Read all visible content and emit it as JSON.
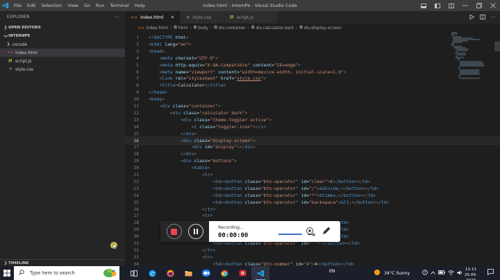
{
  "window": {
    "title": "index.html - InternPe - Visual Studio Code",
    "menu": [
      "File",
      "Edit",
      "Selection",
      "View",
      "Go",
      "Run",
      "Terminal",
      "Help"
    ]
  },
  "explorer": {
    "header": "EXPLORER",
    "more": "···",
    "open_editors": "OPEN EDITORS",
    "project": "INTERNPE",
    "files": [
      {
        "name": ".vscode",
        "kind": "folder"
      },
      {
        "name": "index.html",
        "kind": "html",
        "icon": "<>"
      },
      {
        "name": "script.js",
        "kind": "js",
        "icon": "JS"
      },
      {
        "name": "style.css",
        "kind": "css",
        "icon": "#"
      }
    ],
    "timeline": "TIMELINE"
  },
  "tabs": [
    {
      "label": "index.html",
      "icon": "<>",
      "active": true,
      "color": "#e37933"
    },
    {
      "label": "style.css",
      "icon": "#",
      "active": false,
      "color": "#519aba"
    },
    {
      "label": "script.js",
      "icon": "JS",
      "active": false,
      "color": "#cbcb41"
    }
  ],
  "breadcrumb": [
    "index.html",
    "html",
    "body",
    "div.container",
    "div.calculator.dark",
    "div.display-screen"
  ],
  "current_line": 16,
  "code": [
    {
      "n": "1",
      "indent": 1,
      "t": [
        [
          "p",
          "<!"
        ],
        [
          "d",
          "DOCTYPE"
        ],
        [
          "a",
          " html"
        ],
        [
          "p",
          ">"
        ]
      ]
    },
    {
      "n": "2",
      "indent": 1,
      "t": [
        [
          "p",
          "<"
        ],
        [
          "g",
          "html"
        ],
        [
          "a",
          " lang"
        ],
        [
          "x",
          "="
        ],
        [
          "s",
          "\"en\""
        ],
        [
          "p",
          ">"
        ]
      ]
    },
    {
      "n": "3",
      "indent": 1,
      "t": [
        [
          "p",
          "<"
        ],
        [
          "g",
          "head"
        ],
        [
          "p",
          ">"
        ]
      ]
    },
    {
      "n": "4",
      "indent": 2,
      "t": [
        [
          "p",
          "<"
        ],
        [
          "g",
          "meta"
        ],
        [
          "a",
          " charset"
        ],
        [
          "x",
          "="
        ],
        [
          "s",
          "\"UTF-8\""
        ],
        [
          "p",
          ">"
        ]
      ]
    },
    {
      "n": "5",
      "indent": 2,
      "t": [
        [
          "p",
          "<"
        ],
        [
          "g",
          "meta"
        ],
        [
          "a",
          " http-equiv"
        ],
        [
          "x",
          "="
        ],
        [
          "s",
          "\"X-UA-Compatible\""
        ],
        [
          "a",
          " content"
        ],
        [
          "x",
          "="
        ],
        [
          "s",
          "\"IE=edge\""
        ],
        [
          "p",
          ">"
        ]
      ]
    },
    {
      "n": "6",
      "indent": 2,
      "t": [
        [
          "p",
          "<"
        ],
        [
          "g",
          "meta"
        ],
        [
          "a",
          " name"
        ],
        [
          "x",
          "="
        ],
        [
          "s",
          "\"viewport\""
        ],
        [
          "a",
          " content"
        ],
        [
          "x",
          "="
        ],
        [
          "s",
          "\"width=device-width, initial-scale=1.0\""
        ],
        [
          "p",
          ">"
        ]
      ]
    },
    {
      "n": "7",
      "indent": 2,
      "t": [
        [
          "p",
          "<"
        ],
        [
          "g",
          "link"
        ],
        [
          "a",
          " rel"
        ],
        [
          "x",
          "="
        ],
        [
          "s",
          "\"stylesheet\""
        ],
        [
          "a",
          " href"
        ],
        [
          "x",
          "="
        ],
        [
          "s",
          "\""
        ],
        [
          "l",
          "style.css"
        ],
        [
          "s",
          "\""
        ],
        [
          "p",
          ">"
        ]
      ]
    },
    {
      "n": "8",
      "indent": 2,
      "t": [
        [
          "p",
          "<"
        ],
        [
          "g",
          "title"
        ],
        [
          "p",
          ">"
        ],
        [
          "x",
          "Calculator"
        ],
        [
          "p",
          "</"
        ],
        [
          "g",
          "title"
        ],
        [
          "p",
          ">"
        ]
      ]
    },
    {
      "n": "9",
      "indent": 1,
      "t": [
        [
          "p",
          "</"
        ],
        [
          "g",
          "head"
        ],
        [
          "p",
          ">"
        ]
      ]
    },
    {
      "n": "10",
      "indent": 1,
      "t": [
        [
          "p",
          "<"
        ],
        [
          "g",
          "body"
        ],
        [
          "p",
          ">"
        ]
      ]
    },
    {
      "n": "11",
      "indent": 2,
      "t": [
        [
          "p",
          "<"
        ],
        [
          "g",
          "div"
        ],
        [
          "a",
          " class"
        ],
        [
          "x",
          "="
        ],
        [
          "s",
          "\"container\""
        ],
        [
          "p",
          ">"
        ]
      ]
    },
    {
      "n": "12",
      "indent": 3,
      "t": [
        [
          "p",
          "<"
        ],
        [
          "g",
          "div"
        ],
        [
          "a",
          " class"
        ],
        [
          "x",
          "="
        ],
        [
          "s",
          "\"calculator dark\""
        ],
        [
          "p",
          ">"
        ]
      ]
    },
    {
      "n": "13",
      "indent": 4,
      "t": [
        [
          "p",
          "<"
        ],
        [
          "g",
          "div"
        ],
        [
          "a",
          " class"
        ],
        [
          "x",
          "="
        ],
        [
          "s",
          "\"theme-toggler active\""
        ],
        [
          "p",
          ">"
        ]
      ]
    },
    {
      "n": "14",
      "indent": 5,
      "t": [
        [
          "p",
          "<"
        ],
        [
          "g",
          "i"
        ],
        [
          "a",
          " class"
        ],
        [
          "x",
          "="
        ],
        [
          "s",
          "\"toggler-icon\""
        ],
        [
          "p",
          "></"
        ],
        [
          "g",
          "i"
        ],
        [
          "p",
          ">"
        ]
      ]
    },
    {
      "n": "15",
      "indent": 4,
      "t": [
        [
          "p",
          "</"
        ],
        [
          "g",
          "div"
        ],
        [
          "p",
          ">"
        ]
      ]
    },
    {
      "n": "16",
      "indent": 4,
      "t": [
        [
          "p",
          "<"
        ],
        [
          "g",
          "div"
        ],
        [
          "a",
          " class"
        ],
        [
          "x",
          "="
        ],
        [
          "s",
          "\"display-screen\""
        ],
        [
          "p",
          ">"
        ]
      ]
    },
    {
      "n": "17",
      "indent": 5,
      "t": [
        [
          "p",
          "<"
        ],
        [
          "g",
          "div"
        ],
        [
          "a",
          " id"
        ],
        [
          "x",
          "="
        ],
        [
          "s",
          "\"display\""
        ],
        [
          "p",
          "></"
        ],
        [
          "g",
          "div"
        ],
        [
          "p",
          ">"
        ]
      ]
    },
    {
      "n": "18",
      "indent": 4,
      "t": [
        [
          "p",
          "</"
        ],
        [
          "g",
          "div"
        ],
        [
          "p",
          ">"
        ]
      ]
    },
    {
      "n": "19",
      "indent": 4,
      "t": [
        [
          "p",
          "<"
        ],
        [
          "g",
          "div"
        ],
        [
          "a",
          " class"
        ],
        [
          "x",
          "="
        ],
        [
          "s",
          "\"buttons\""
        ],
        [
          "p",
          ">"
        ]
      ]
    },
    {
      "n": "20",
      "indent": 5,
      "t": [
        [
          "p",
          "<"
        ],
        [
          "g",
          "table"
        ],
        [
          "p",
          ">"
        ]
      ]
    },
    {
      "n": "21",
      "indent": 6,
      "t": [
        [
          "p",
          "<"
        ],
        [
          "g",
          "tr"
        ],
        [
          "p",
          ">"
        ]
      ]
    },
    {
      "n": "22",
      "indent": 7,
      "t": [
        [
          "p",
          "<"
        ],
        [
          "g",
          "td"
        ],
        [
          "p",
          "><"
        ],
        [
          "g",
          "button"
        ],
        [
          "a",
          " class"
        ],
        [
          "x",
          "="
        ],
        [
          "s",
          "\"btn-operator\""
        ],
        [
          "a",
          " id"
        ],
        [
          "x",
          "="
        ],
        [
          "s",
          "\"clear\""
        ],
        [
          "p",
          ">"
        ],
        [
          "x",
          "C"
        ],
        [
          "p",
          "</"
        ],
        [
          "g",
          "button"
        ],
        [
          "p",
          "></"
        ],
        [
          "g",
          "td"
        ],
        [
          "p",
          ">"
        ]
      ]
    },
    {
      "n": "23",
      "indent": 7,
      "t": [
        [
          "p",
          "<"
        ],
        [
          "g",
          "td"
        ],
        [
          "p",
          "><"
        ],
        [
          "g",
          "button"
        ],
        [
          "a",
          " class"
        ],
        [
          "x",
          "="
        ],
        [
          "s",
          "\"btn-operator\""
        ],
        [
          "a",
          " id"
        ],
        [
          "x",
          "="
        ],
        [
          "s",
          "\"/\""
        ],
        [
          "p",
          ">"
        ],
        [
          "e",
          "&divide;"
        ],
        [
          "p",
          "</"
        ],
        [
          "g",
          "button"
        ],
        [
          "p",
          "></"
        ],
        [
          "g",
          "td"
        ],
        [
          "p",
          ">"
        ]
      ]
    },
    {
      "n": "24",
      "indent": 7,
      "t": [
        [
          "p",
          "<"
        ],
        [
          "g",
          "td"
        ],
        [
          "p",
          "><"
        ],
        [
          "g",
          "button"
        ],
        [
          "a",
          " class"
        ],
        [
          "x",
          "="
        ],
        [
          "s",
          "\"btn-operator\""
        ],
        [
          "a",
          " id"
        ],
        [
          "x",
          "="
        ],
        [
          "s",
          "\"*\""
        ],
        [
          "p",
          ">"
        ],
        [
          "e",
          "&times;"
        ],
        [
          "p",
          "</"
        ],
        [
          "g",
          "button"
        ],
        [
          "p",
          "></"
        ],
        [
          "g",
          "td"
        ],
        [
          "p",
          ">"
        ]
      ]
    },
    {
      "n": "25",
      "indent": 7,
      "t": [
        [
          "p",
          "<"
        ],
        [
          "g",
          "td"
        ],
        [
          "p",
          "><"
        ],
        [
          "g",
          "button"
        ],
        [
          "a",
          " class"
        ],
        [
          "x",
          "="
        ],
        [
          "s",
          "\"btn-operator\""
        ],
        [
          "a",
          " id"
        ],
        [
          "x",
          "="
        ],
        [
          "s",
          "\"backspace\""
        ],
        [
          "p",
          ">"
        ],
        [
          "e",
          "&lt;"
        ],
        [
          "p",
          "</"
        ],
        [
          "g",
          "button"
        ],
        [
          "p",
          "></"
        ],
        [
          "g",
          "td"
        ],
        [
          "p",
          ">"
        ]
      ]
    },
    {
      "n": "26",
      "indent": 6,
      "t": [
        [
          "p",
          "</"
        ],
        [
          "g",
          "tr"
        ],
        [
          "p",
          ">"
        ]
      ]
    },
    {
      "n": "27",
      "indent": 6,
      "t": [
        [
          "p",
          "<"
        ],
        [
          "g",
          "tr"
        ],
        [
          "p",
          ">"
        ]
      ]
    },
    {
      "n": "28",
      "indent": 7,
      "t": [
        [
          "p",
          "                                     "
        ],
        [
          "p",
          "</"
        ],
        [
          "g",
          "button"
        ],
        [
          "p",
          "></"
        ],
        [
          "g",
          "td"
        ],
        [
          "p",
          ">"
        ]
      ]
    },
    {
      "n": "29",
      "indent": 7,
      "t": [
        [
          "p",
          "                                     "
        ],
        [
          "p",
          "</"
        ],
        [
          "g",
          "button"
        ],
        [
          "p",
          "></"
        ],
        [
          "g",
          "td"
        ],
        [
          "p",
          ">"
        ]
      ]
    },
    {
      "n": "30",
      "indent": 7,
      "t": [
        [
          "p",
          "                                     "
        ],
        [
          "p",
          "</"
        ],
        [
          "g",
          "button"
        ],
        [
          "p",
          "></"
        ],
        [
          "g",
          "td"
        ],
        [
          "p",
          ">"
        ]
      ]
    },
    {
      "n": "31",
      "indent": 7,
      "t": [
        [
          "p",
          "<"
        ],
        [
          "g",
          "td"
        ],
        [
          "p",
          "><"
        ],
        [
          "g",
          "button"
        ],
        [
          "a",
          " class"
        ],
        [
          "x",
          "="
        ],
        [
          "s",
          "\"btn-operator\""
        ],
        [
          "a",
          " id"
        ],
        [
          "x",
          "="
        ],
        [
          "s",
          "\"-\""
        ],
        [
          "p",
          ">"
        ],
        [
          "x",
          "-"
        ],
        [
          "p",
          "</"
        ],
        [
          "g",
          "button"
        ],
        [
          "p",
          "></"
        ],
        [
          "g",
          "td"
        ],
        [
          "p",
          ">"
        ]
      ]
    },
    {
      "n": "32",
      "indent": 6,
      "t": [
        [
          "p",
          "</"
        ],
        [
          "g",
          "tr"
        ],
        [
          "p",
          ">"
        ]
      ]
    },
    {
      "n": "33",
      "indent": 6,
      "t": [
        [
          "p",
          "<"
        ],
        [
          "g",
          "tr"
        ],
        [
          "p",
          ">"
        ]
      ]
    },
    {
      "n": "34",
      "indent": 7,
      "t": [
        [
          "p",
          "<"
        ],
        [
          "g",
          "td"
        ],
        [
          "p",
          "><"
        ],
        [
          "g",
          "button"
        ],
        [
          "a",
          " class"
        ],
        [
          "x",
          "="
        ],
        [
          "s",
          "\"btn-number\""
        ],
        [
          "a",
          " id"
        ],
        [
          "x",
          "="
        ],
        [
          "s",
          "\"4\""
        ],
        [
          "p",
          ">"
        ],
        [
          "x",
          "4"
        ],
        [
          "p",
          "</"
        ],
        [
          "g",
          "button"
        ],
        [
          "p",
          "></"
        ],
        [
          "g",
          "td"
        ],
        [
          "p",
          ">"
        ]
      ]
    }
  ],
  "recorder": {
    "status": "Recording...",
    "time": "00:00:00",
    "stop_color": "#e9474c"
  },
  "taskbar": {
    "search_placeholder": "Type here to search",
    "language": "EN",
    "weather": "34°C  Sunny",
    "time": "11:11",
    "date": "25-05-2023"
  },
  "colors": {
    "accent": "#007acc",
    "html_icon": "#e37933",
    "css_icon": "#519aba",
    "js_icon": "#cbcb41"
  }
}
